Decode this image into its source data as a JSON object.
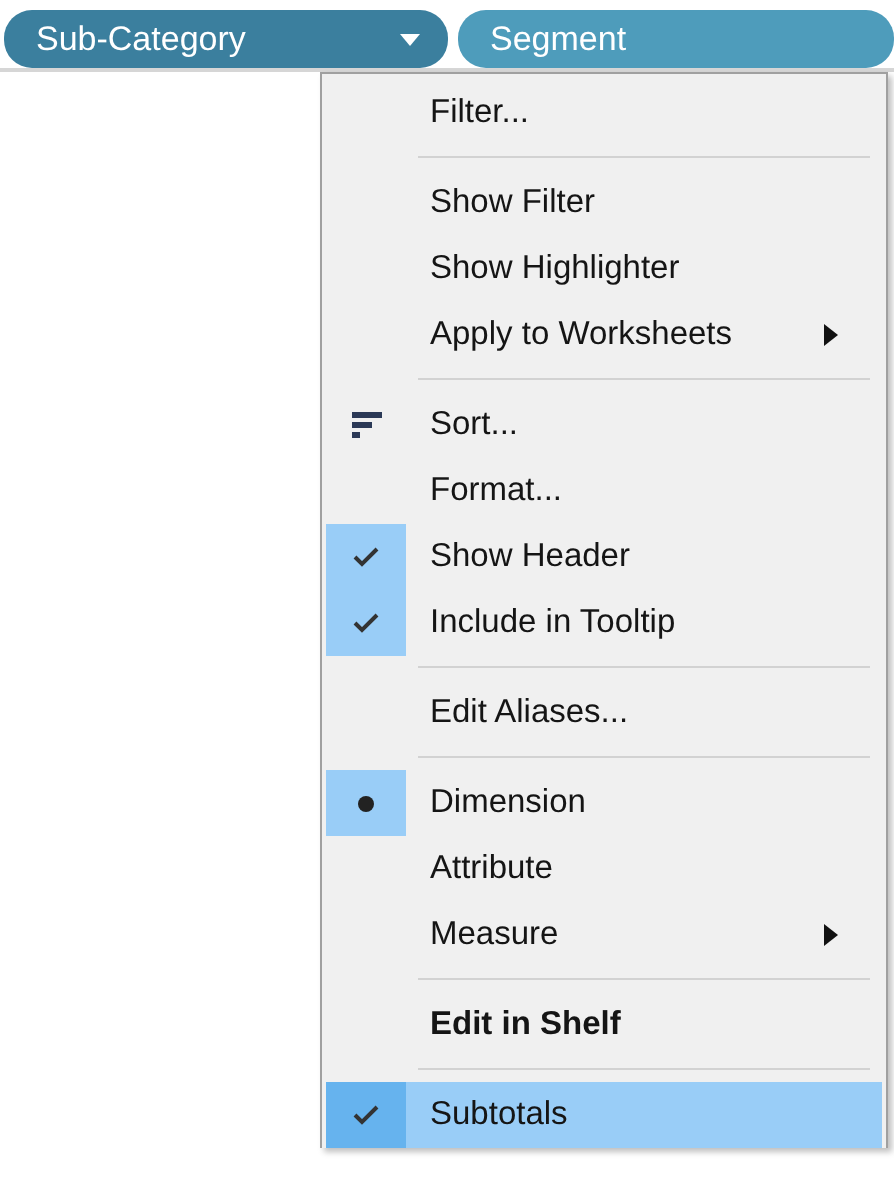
{
  "shelf": {
    "pills": [
      {
        "label": "Sub-Category",
        "dropdown": true
      },
      {
        "label": "Segment",
        "dropdown": false
      }
    ]
  },
  "menu": {
    "items": [
      {
        "kind": "plain",
        "label": "Filter..."
      },
      {
        "kind": "separator"
      },
      {
        "kind": "plain",
        "label": "Show Filter"
      },
      {
        "kind": "plain",
        "label": "Show Highlighter"
      },
      {
        "kind": "plain",
        "label": "Apply to Worksheets",
        "submenu": true
      },
      {
        "kind": "separator"
      },
      {
        "kind": "sort",
        "label": "Sort..."
      },
      {
        "kind": "plain",
        "label": "Format..."
      },
      {
        "kind": "check",
        "label": "Show Header",
        "checked": true
      },
      {
        "kind": "check",
        "label": "Include in Tooltip",
        "checked": true
      },
      {
        "kind": "separator"
      },
      {
        "kind": "plain",
        "label": "Edit Aliases..."
      },
      {
        "kind": "separator"
      },
      {
        "kind": "radio",
        "label": "Dimension",
        "selected": true
      },
      {
        "kind": "radio",
        "label": "Attribute",
        "selected": false
      },
      {
        "kind": "radio",
        "label": "Measure",
        "selected": false,
        "submenu": true
      },
      {
        "kind": "separator"
      },
      {
        "kind": "plain",
        "label": "Edit in Shelf",
        "bold": true
      },
      {
        "kind": "separator"
      },
      {
        "kind": "check",
        "label": "Subtotals",
        "checked": true,
        "highlighted": true
      }
    ]
  }
}
